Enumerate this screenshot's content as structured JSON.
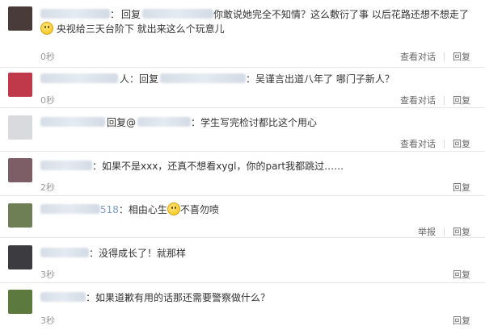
{
  "comments": [
    {
      "reply_word": "回复",
      "text": "你敢说她完全不知情？这么敷衍了事 以后花路还想不想走了",
      "text2": "央视给三天台阶下 就出来这么个玩意儿",
      "time": "0秒",
      "actions": [
        "查看对话",
        "回复"
      ],
      "avatar_color": "#4a3b3b"
    },
    {
      "reply_word": "人：回复",
      "text": "：吴谨言出道八年了 哪门子新人？",
      "time": "0秒",
      "actions": [
        "查看对话",
        "回复"
      ],
      "avatar_color": "#c0394b"
    },
    {
      "reply_word": "回复@",
      "text": "：学生写完检讨都比这个用心",
      "time": "",
      "actions": [
        "查看对话",
        "回复"
      ],
      "avatar_color": "#d8dadd"
    },
    {
      "text": "：如果不是xxx，还真不想看xygl，你的part我都跳过……",
      "time": "2秒",
      "actions": [
        "回复"
      ],
      "avatar_color": "#7d5e66"
    },
    {
      "uid_tail": "518",
      "text": "：相由心生",
      "text_after": "不喜勿喷",
      "time": "",
      "actions": [
        "举报",
        "回复"
      ],
      "avatar_color": "#6f7f55"
    },
    {
      "text": "：没得成长了！就那样",
      "time": "3秒",
      "actions": [
        "回复"
      ],
      "avatar_color": "#3b3b40"
    },
    {
      "text": "：如果道歉有用的话那还需要警察做什么？",
      "time": "3秒",
      "actions": [
        "回复"
      ],
      "avatar_color": "#5c7a3d"
    }
  ]
}
